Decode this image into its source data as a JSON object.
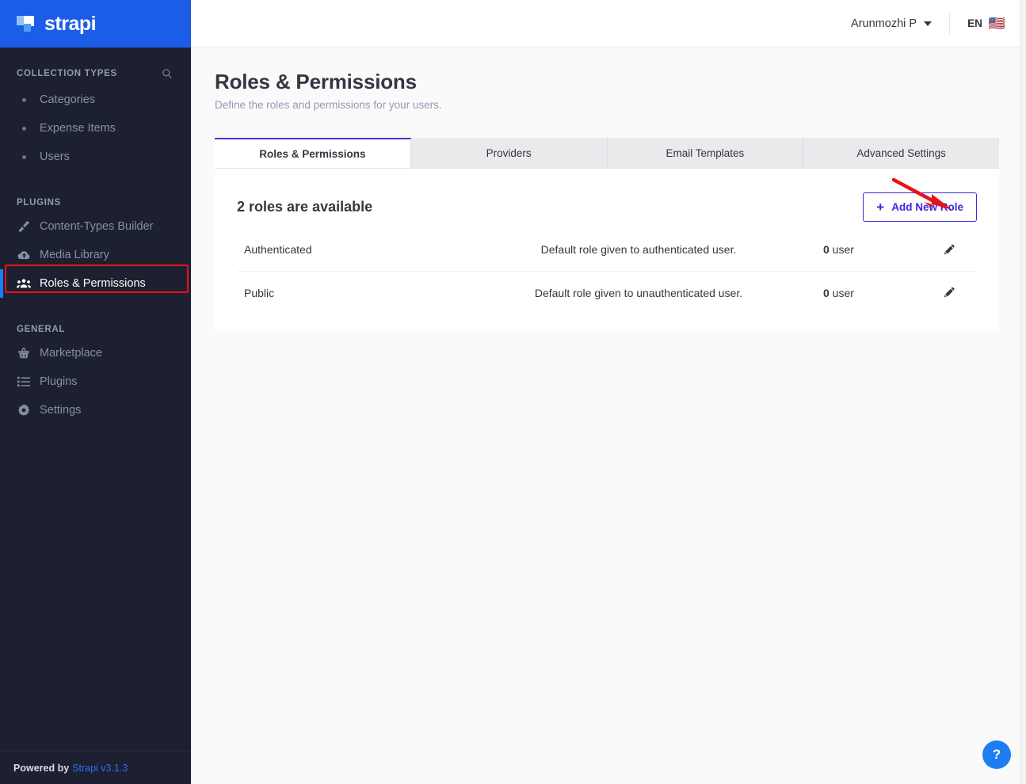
{
  "brand": {
    "name": "strapi",
    "logo_icon": "strapi-logo-icon"
  },
  "sidebar": {
    "sections": [
      {
        "title": "COLLECTION TYPES",
        "has_search": true,
        "search_icon": "search-icon",
        "items": [
          {
            "label": "Categories",
            "icon": "bullet-icon"
          },
          {
            "label": "Expense Items",
            "icon": "bullet-icon"
          },
          {
            "label": "Users",
            "icon": "bullet-icon"
          }
        ]
      },
      {
        "title": "PLUGINS",
        "has_search": false,
        "items": [
          {
            "label": "Content-Types Builder",
            "icon": "paintbrush-icon"
          },
          {
            "label": "Media Library",
            "icon": "cloud-upload-icon"
          },
          {
            "label": "Roles & Permissions",
            "icon": "users-group-icon",
            "active": true
          }
        ]
      },
      {
        "title": "GENERAL",
        "has_search": false,
        "items": [
          {
            "label": "Marketplace",
            "icon": "basket-icon"
          },
          {
            "label": "Plugins",
            "icon": "list-icon"
          },
          {
            "label": "Settings",
            "icon": "gear-icon"
          }
        ]
      }
    ],
    "footer": {
      "prefix": "Powered by",
      "version_link": "Strapi v3.1.3"
    }
  },
  "topbar": {
    "user_name": "Arunmozhi P",
    "caret_icon": "chevron-down-icon",
    "language_code": "EN",
    "flag_icon": "us-flag-icon",
    "flag_glyph": "🇺🇸"
  },
  "page": {
    "title": "Roles & Permissions",
    "subtitle": "Define the roles and permissions for your users."
  },
  "tabs": [
    {
      "label": "Roles & Permissions",
      "active": true
    },
    {
      "label": "Providers",
      "active": false
    },
    {
      "label": "Email Templates",
      "active": false
    },
    {
      "label": "Advanced Settings",
      "active": false
    }
  ],
  "panel": {
    "heading": "2 roles are available",
    "add_button": {
      "label": "Add New Role",
      "plus_glyph": "+",
      "icon": "plus-icon"
    },
    "rows": [
      {
        "name": "Authenticated",
        "description": "Default role given to authenticated user.",
        "user_count": "0",
        "user_count_suffix": " user",
        "edit_icon": "pencil-icon"
      },
      {
        "name": "Public",
        "description": "Default role given to unauthenticated user.",
        "user_count": "0",
        "user_count_suffix": " user",
        "edit_icon": "pencil-icon"
      }
    ]
  },
  "help": {
    "label": "?",
    "icon": "question-mark-icon"
  },
  "annotations": {
    "arrow_color": "#e8121b",
    "highlight_color": "#e8121b"
  },
  "colors": {
    "brand_blue": "#1c5de7",
    "sidebar_bg": "#1c2030",
    "accent_purple": "#3b28e0",
    "tab_active_border": "#4b2ee0",
    "help_blue": "#1c7ef0"
  }
}
